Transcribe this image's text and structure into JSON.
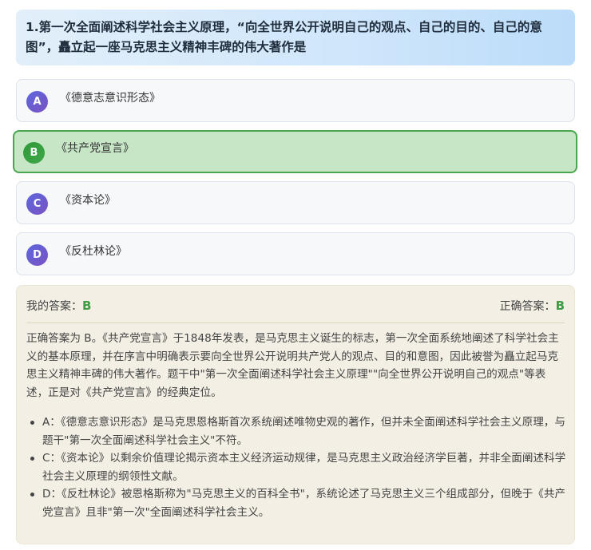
{
  "question": {
    "text": "1.第一次全面阐述科学社会主义原理，“向全世界公开说明自己的观点、自己的目的、自己的意图”，矗立起一座马克思主义精神丰碑的伟大著作是"
  },
  "options": [
    {
      "letter": "A",
      "text": "《德意志意识形态》",
      "selected": false
    },
    {
      "letter": "B",
      "text": "《共产党宣言》",
      "selected": true
    },
    {
      "letter": "C",
      "text": "《资本论》",
      "selected": false
    },
    {
      "letter": "D",
      "text": "《反杜林论》",
      "selected": false
    }
  ],
  "analysis": {
    "my_answer_label": "我的答案：",
    "my_answer": "B",
    "correct_answer_label": "正确答案：",
    "correct_answer": "B",
    "explanation": "正确答案为 B。《共产党宣言》于1848年发表，是马克思主义诞生的标志，第一次全面系统地阐述了科学社会主义的基本原理，并在序言中明确表示要向全世界公开说明共产党人的观点、目的和意图，因此被誉为矗立起马克思主义精神丰碑的伟大著作。题干中\"第一次全面阐述科学社会主义原理\"\"向全世界公开说明自己的观点\"等表述，正是对《共产党宣言》的经典定位。",
    "points": [
      "A：《德意志意识形态》是马克思恩格斯首次系统阐述唯物史观的著作，但并未全面阐述科学社会主义原理，与题干\"第一次全面阐述科学社会主义\"不符。",
      "C：《资本论》以剩余价值理论揭示资本主义经济运动规律，是马克思主义政治经济学巨著，并非全面阐述科学社会主义原理的纲领性文献。",
      "D：《反杜林论》被恩格斯称为\"马克思主义的百科全书\"，系统论述了马克思主义三个组成部分，但晚于《共产党宣言》且非\"第一次\"全面阐述科学社会主义。"
    ]
  },
  "colors": {
    "correct_green": "#3f9c45",
    "badge_purple": "#6a5cd4",
    "selected_bg": "#c6e6c6"
  }
}
